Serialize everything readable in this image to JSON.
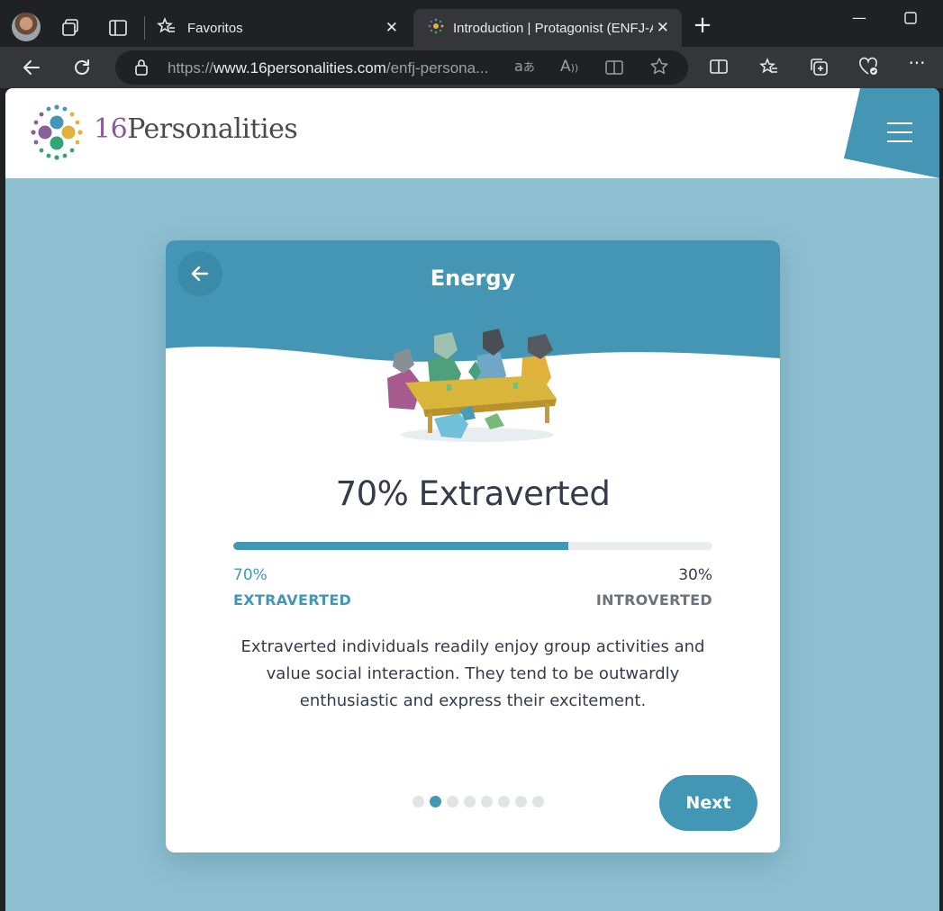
{
  "browser": {
    "tabs": [
      {
        "label": "Favoritos",
        "active": false
      },
      {
        "label": "Introduction | Protagonist (ENFJ-A)",
        "active": true
      }
    ],
    "new_tab_symbol": "+",
    "url_prefix": "https://",
    "url_domain": "www.16personalities.com",
    "url_path": "/enfj-persona...",
    "icons": [
      "profile-avatar",
      "workspaces-icon",
      "tab-actions-icon",
      "favorites-icon",
      "back-icon",
      "refresh-icon",
      "lock-icon",
      "translate-icon",
      "read-aloud-icon",
      "immersive-reader-icon",
      "star-icon",
      "split-screen-icon",
      "favorites-bar-icon",
      "collections-icon",
      "browser-essentials-icon",
      "more-icon"
    ]
  },
  "site": {
    "logo_number": "16",
    "logo_word": "Personalities",
    "menu_icon": "hamburger-icon"
  },
  "card": {
    "title": "Energy",
    "headline": "70% Extraverted",
    "progress": 0.7,
    "left_percent": "70%",
    "left_trait": "EXTRAVERTED",
    "right_percent": "30%",
    "right_trait": "INTROVERTED",
    "description": "Extraverted individuals readily enjoy group activities and value social interaction. They tend to be outwardly enthusiastic and express their excitement.",
    "pagination": {
      "total": 8,
      "current": 2
    },
    "next_label": "Next"
  },
  "colors": {
    "accent": "#4298b4",
    "header_blue": "#4596b5",
    "page_bg": "#8dbfd1",
    "text_dark": "#343c4b"
  }
}
